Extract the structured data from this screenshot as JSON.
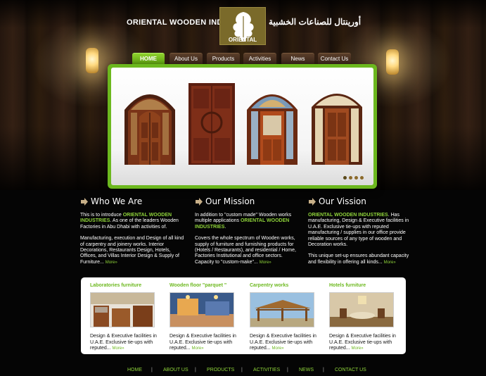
{
  "header": {
    "brand_en": "ORIENTAL WOODEN INDUSTRIES",
    "brand_ar": "أورينتال للصناعات الخشبية",
    "logo_text": "ORIENTAL"
  },
  "nav": {
    "items": [
      {
        "label": "HOME"
      },
      {
        "label": "About Us"
      },
      {
        "label": "Products"
      },
      {
        "label": "Activities"
      },
      {
        "label": "News"
      },
      {
        "label": "Contact Us"
      }
    ]
  },
  "columns": {
    "who": {
      "title": "Who We Are",
      "p1_a": "This is to introduce ",
      "p1_b": "ORIENTAL WOODEN INDUSTRIES",
      "p1_c": ". As one of the leaders Wooden Factories in Abu Dhabi with activities of.",
      "p2": "Manufacturing, execution and Design of all kind of carpentry and joinery works. Interior Decorations, Restaurants Design, Hotels, Offices, and Villas Interior Design & Supply of Furniture... ",
      "more": "More»"
    },
    "mission": {
      "title": "Our Mission",
      "p1_a": "In addition to \"custom made\" Wooden works multiple applications ",
      "p1_b": "ORIENTAL WOODEN INDUSTRIES",
      "p1_c": ".",
      "p2": "Covers the whole spectrum of Wooden works, supply of furniture and furnishing products for (Hotels / Restaurants), and residential / Home, Factories Institutional and office sectors. Capacity to \"custom-make\"... ",
      "more": "More»"
    },
    "vision": {
      "title": "Our Vission",
      "p1_b": "ORIENTAL WOODEN INDUSTRIES",
      "p1_c": ". Has manufacturing, Design & Executive facilities in U.A.E. Exclusive tie-ups with reputed manufacturing / supplies in our office provide reliable sources of any type of wooden and Decoration works.",
      "p2": "This unique set-up ensures abundant capacity and flexibility in offering all kinds... ",
      "more": "More»"
    }
  },
  "products": [
    {
      "title": "Laboratories furniture",
      "desc": "Design & Executive facilities in U.A.E. Exclusive tie-ups with reputed... ",
      "more": "More»"
    },
    {
      "title": "Wooden floor \"parquet \"",
      "desc": "Design & Executive facilities in U.A.E. Exclusive tie-ups with reputed... ",
      "more": "More»"
    },
    {
      "title": "Carpentry works",
      "desc": "Design & Executive facilities in U.A.E. Exclusive tie-ups with reputed... ",
      "more": "More»"
    },
    {
      "title": "Hotels furniture",
      "desc": "Design & Executive facilities in U.A.E. Exclusive tie-ups with reputed... ",
      "more": "More»"
    }
  ],
  "footer": {
    "links": [
      "HOME",
      "ABOUT US",
      "PRODUCTS",
      "ACTIVITIES",
      "NEWS",
      "CONTACT US"
    ],
    "separator": "|"
  },
  "colors": {
    "accent_green": "#6cb81e",
    "wood_dark": "#2a1a10"
  },
  "slider": {
    "active_slide": 1,
    "slide_count": 4
  }
}
